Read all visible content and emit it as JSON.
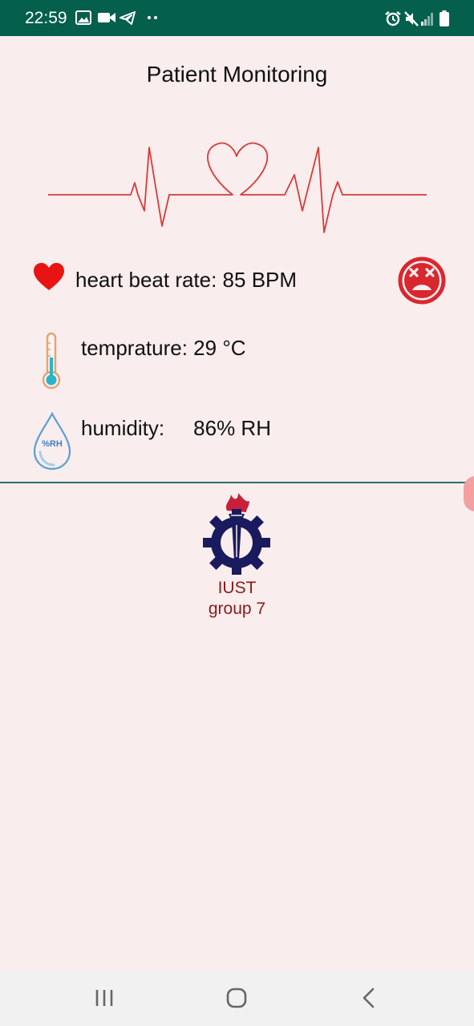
{
  "status_bar": {
    "time": "22:59",
    "left_icons": [
      "image-icon",
      "video-icon",
      "telegram-icon",
      "more-dots-icon"
    ],
    "right_icons": [
      "alarm-icon",
      "mute-icon",
      "signal-icon",
      "battery-icon"
    ],
    "background_color": "#045f4d"
  },
  "header": {
    "title": "Patient Monitoring"
  },
  "ecg_graphic": {
    "icon": "heartbeat-line-icon",
    "color": "#d93a3a"
  },
  "readings": {
    "heart_rate": {
      "label": "heart beat rate: 85 BPM",
      "icon": "heart-icon",
      "status_icon": "sad-face-icon"
    },
    "temperature": {
      "label": "temprature: 29 °C",
      "icon": "thermometer-icon"
    },
    "humidity": {
      "label": "humidity:     86% RH",
      "icon": "humidity-drop-icon",
      "icon_text": "%RH"
    }
  },
  "footer_logo": {
    "line1": "IUST",
    "line2": "group 7",
    "icon": "iust-logo-icon"
  },
  "nav_bar": {
    "buttons": [
      "recent-apps-button",
      "home-button",
      "back-button"
    ]
  },
  "colors": {
    "background": "#f9eded",
    "accent_red": "#e02b2b",
    "divider": "#2d6e68"
  }
}
